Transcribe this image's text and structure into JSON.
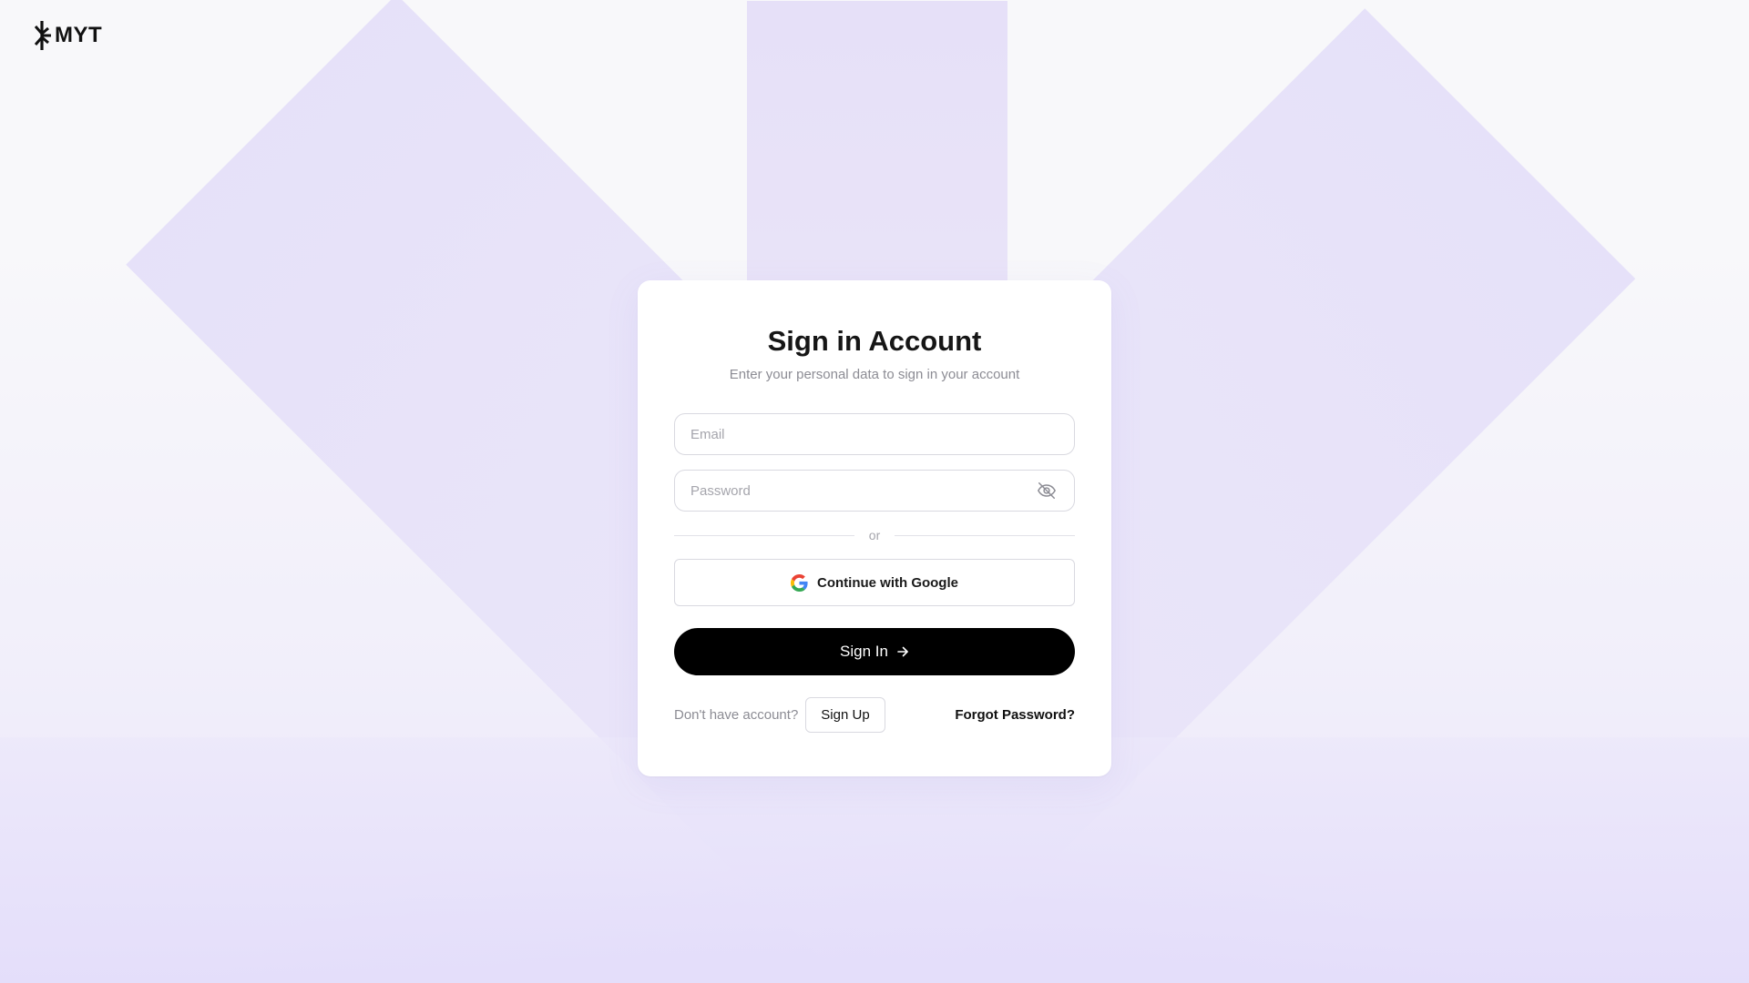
{
  "brand": {
    "logo_text": "MYT",
    "logo_icon": "myt-logo-icon"
  },
  "colors": {
    "background": "#f8f8fa",
    "accent_lavender": "#e6e0f8",
    "primary_button": "#000000",
    "card": "#ffffff"
  },
  "signin_card": {
    "title": "Sign in Account",
    "subtitle": "Enter your personal data to sign in your account",
    "email_placeholder": "Email",
    "email_value": "",
    "password_placeholder": "Password",
    "password_value": "",
    "password_toggle_icon": "eye-off-icon",
    "divider_text": "or",
    "google_button_label": "Continue with Google",
    "google_icon": "google-icon",
    "signin_button_label": "Sign In",
    "signin_button_icon": "arrow-right-icon",
    "no_account_text": "Don't have account?",
    "signup_button_label": "Sign Up",
    "forgot_password_label": "Forgot Password?"
  }
}
